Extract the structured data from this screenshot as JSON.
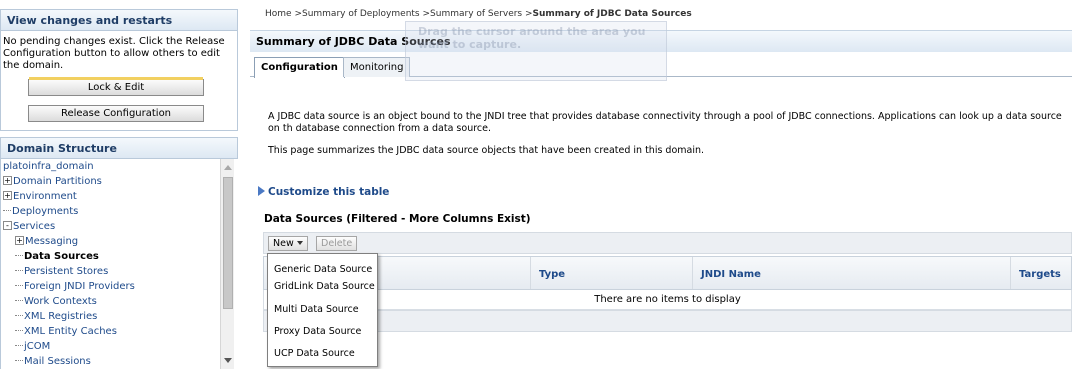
{
  "change_center": {
    "title": "View changes and restarts",
    "message": "No pending changes exist. Click the Release Configuration button to allow others to edit the domain.",
    "lock_button": "Lock & Edit",
    "release_button": "Release Configuration"
  },
  "domain_structure": {
    "title": "Domain Structure",
    "items": [
      {
        "label": "platoinfra_domain",
        "toggle": ""
      },
      {
        "label": "Domain Partitions",
        "toggle": "+"
      },
      {
        "label": "Environment",
        "toggle": "+"
      },
      {
        "label": "Deployments",
        "toggle": ""
      },
      {
        "label": "Services",
        "toggle": "-"
      },
      {
        "label": "Messaging",
        "toggle": "+"
      },
      {
        "label": "Data Sources",
        "toggle": ""
      },
      {
        "label": "Persistent Stores",
        "toggle": ""
      },
      {
        "label": "Foreign JNDI Providers",
        "toggle": ""
      },
      {
        "label": "Work Contexts",
        "toggle": ""
      },
      {
        "label": "XML Registries",
        "toggle": ""
      },
      {
        "label": "XML Entity Caches",
        "toggle": ""
      },
      {
        "label": "jCOM",
        "toggle": ""
      },
      {
        "label": "Mail Sessions",
        "toggle": ""
      }
    ]
  },
  "breadcrumb": {
    "home": "Home",
    "deployments": "Summary of Deployments",
    "servers": "Summary of Servers",
    "current": "Summary of JDBC Data Sources",
    "sep": " >"
  },
  "page": {
    "title": "Summary of JDBC Data Sources",
    "tabs": [
      "Configuration",
      "Monitoring"
    ],
    "description": "A JDBC data source is an object bound to the JNDI tree that provides database connectivity through a pool of JDBC connections. Applications can look up a data source on th database connection from a data source.",
    "summary": "This page summarizes the JDBC data source objects that have been created in this domain.",
    "customize_link": "Customize this table",
    "ghost_text": "Drag the cursor around the area you want to capture."
  },
  "table": {
    "title": "Data Sources (Filtered - More Columns Exist)",
    "new_button": "New",
    "delete_button": "Delete",
    "columns": [
      "Type",
      "JNDI Name",
      "Targets"
    ],
    "empty_message": "There are no items to display"
  },
  "new_menu": {
    "items": [
      "Generic Data Source",
      "GridLink Data Source",
      "Multi Data Source",
      "Proxy Data Source",
      "UCP Data Source"
    ]
  },
  "colors": {
    "header_text": "#1f3d66",
    "link": "#1e4a8a",
    "accent_lock": "#f2d060"
  }
}
